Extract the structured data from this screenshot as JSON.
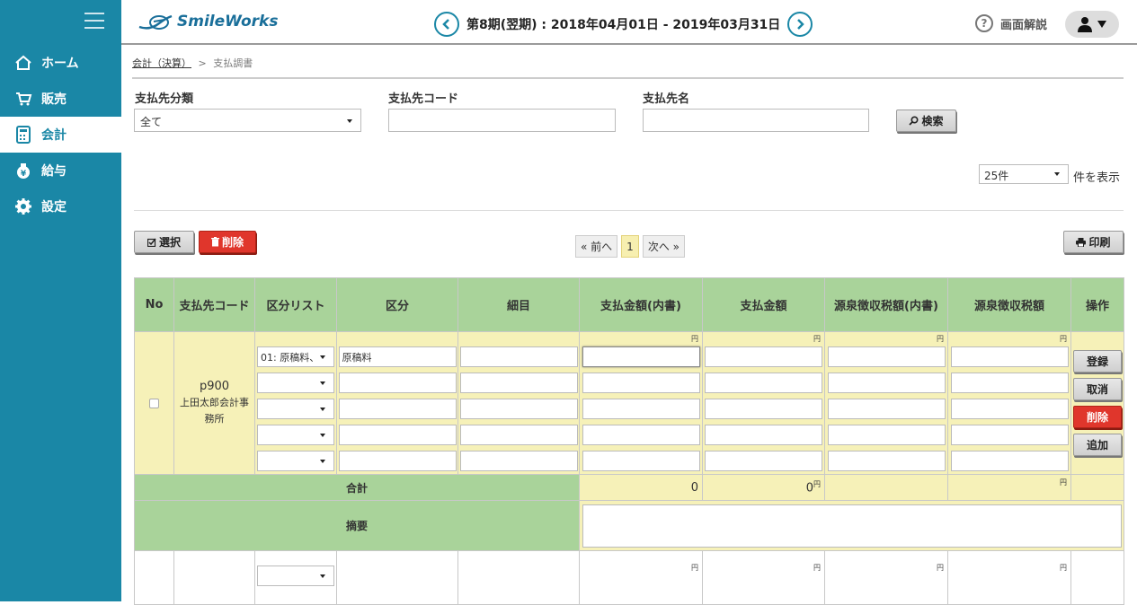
{
  "app": {
    "logo_text": "SmileWorks",
    "brand_color": "#1a87a6"
  },
  "sidebar": {
    "items": [
      {
        "label": "ホーム",
        "icon": "home-icon"
      },
      {
        "label": "販売",
        "icon": "cart-icon"
      },
      {
        "label": "会計",
        "icon": "calculator-icon",
        "active": true
      },
      {
        "label": "給与",
        "icon": "yen-bag-icon"
      },
      {
        "label": "設定",
        "icon": "gear-icon"
      }
    ]
  },
  "header": {
    "period": "第8期(翌期) : 2018年04月01日 - 2019年03月31日",
    "help_label": "画面解説",
    "help_symbol": "?"
  },
  "breadcrumb": {
    "parent": "会計（決算）",
    "separator": ">",
    "current": "支払調書"
  },
  "filters": {
    "category_label": "支払先分類",
    "category_value": "全て",
    "code_label": "支払先コード",
    "code_value": "",
    "name_label": "支払先名",
    "name_value": "",
    "search_label": "検索"
  },
  "per_page": {
    "value": "25件",
    "suffix": "件を表示"
  },
  "toolbar": {
    "select_label": "選択",
    "delete_label": "削除",
    "print_label": "印刷"
  },
  "pager": {
    "prev": "« 前へ",
    "current": "1",
    "next": "次へ »"
  },
  "table": {
    "headers": {
      "no": "No",
      "code": "支払先コード",
      "name": "支払先名",
      "category_list": "区分リスト",
      "category": "区分",
      "detail": "細目",
      "amount_inner": "支払金額(内書)",
      "amount": "支払金額",
      "tax_inner": "源泉徴収税額(内書)",
      "tax": "源泉徴収税額",
      "ops": "操作"
    },
    "yen": "円",
    "record": {
      "code": "p900",
      "name": "上田太郎会計事務所",
      "rows": [
        {
          "category_list": "01: 原稿料、",
          "category": "原稿料"
        },
        {
          "category_list": "",
          "category": ""
        },
        {
          "category_list": "",
          "category": ""
        },
        {
          "category_list": "",
          "category": ""
        },
        {
          "category_list": "",
          "category": ""
        }
      ],
      "buttons": {
        "register": "登録",
        "cancel": "取消",
        "delete": "削除",
        "add": "追加"
      },
      "total_label": "合計",
      "total_amount_inner": "0",
      "total_amount": "0",
      "memo_label": "摘要"
    }
  }
}
